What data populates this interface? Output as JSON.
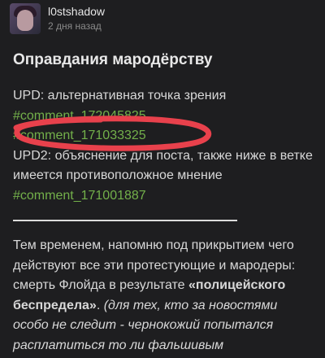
{
  "post": {
    "username": "l0stshadow",
    "timestamp": "2 дня назад",
    "title": "Оправдания мародёрству"
  },
  "content": {
    "upd_label": "UPD: альтернативная точка зрения",
    "link1": "#comment_172045825",
    "link2": "#comment_171033325",
    "upd2_label": "UPD2: объяснение для поста, также ниже в ветке имеется противоположное мнение",
    "link3": "#comment_171001887",
    "para_intro": "Тем временем, напомню под прикрытием чего действуют все эти протестующие и мародеры: смерть Флойда в результате ",
    "para_bold": "«полицейского беспредела»",
    "para_dot": ". ",
    "para_italic": "(для тех, кто за новостями особо не следит - чернокожий попытался расплатиться то ли фальшивым"
  },
  "colors": {
    "background": "#1e1e20",
    "link": "#73b04a",
    "annotation": "#e8414c"
  }
}
